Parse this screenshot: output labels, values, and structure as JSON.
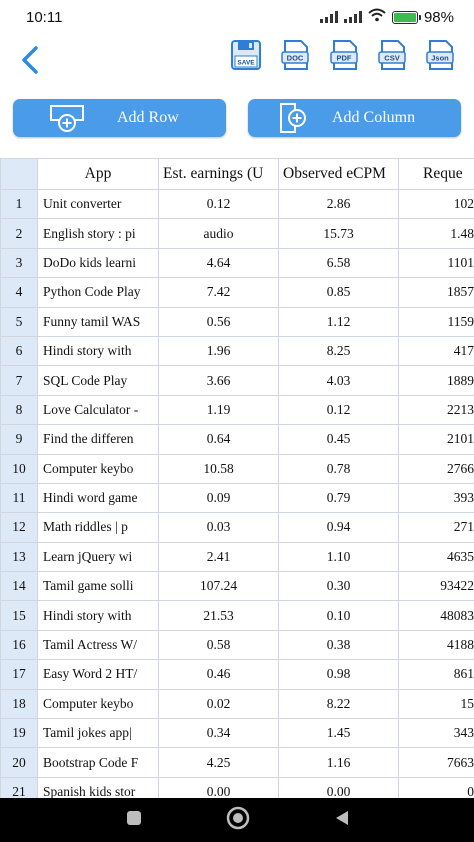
{
  "status": {
    "time": "10:11",
    "battery": "98%",
    "icons": [
      "signal-icon",
      "signal-icon",
      "wifi-icon",
      "battery-icon"
    ]
  },
  "toolbar": {
    "back_icon": "back-arrow-icon",
    "formats": [
      {
        "name": "save",
        "label": "SAVE"
      },
      {
        "name": "doc",
        "label": "DOC"
      },
      {
        "name": "pdf",
        "label": "PDF"
      },
      {
        "name": "csv",
        "label": "CSV"
      },
      {
        "name": "json",
        "label": "Json"
      }
    ],
    "accent": "#2d8ae0"
  },
  "actions": {
    "add_row": "Add Row",
    "add_column": "Add Column",
    "button_color": "#4a9be8"
  },
  "table": {
    "headers": [
      "App",
      "Est. earnings (U",
      "Observed eCPM",
      "Reque"
    ],
    "rows": [
      {
        "n": "1",
        "app": "Unit converter",
        "earn": "0.12",
        "ecpm": "2.86",
        "req": "102"
      },
      {
        "n": "2",
        "app": "English story : pi",
        "earn": "audio",
        "ecpm": "15.73",
        "req": "1.48"
      },
      {
        "n": "3",
        "app": "DoDo kids learni",
        "earn": "4.64",
        "ecpm": "6.58",
        "req": "1101"
      },
      {
        "n": "4",
        "app": "Python Code Play",
        "earn": "7.42",
        "ecpm": "0.85",
        "req": "1857"
      },
      {
        "n": "5",
        "app": "Funny tamil WAS",
        "earn": "0.56",
        "ecpm": "1.12",
        "req": "1159"
      },
      {
        "n": "6",
        "app": "Hindi story with",
        "earn": "1.96",
        "ecpm": "8.25",
        "req": "417"
      },
      {
        "n": "7",
        "app": "SQL Code Play",
        "earn": "3.66",
        "ecpm": "4.03",
        "req": "1889"
      },
      {
        "n": "8",
        "app": "Love Calculator -",
        "earn": "1.19",
        "ecpm": "0.12",
        "req": "2213"
      },
      {
        "n": "9",
        "app": "Find the differen",
        "earn": "0.64",
        "ecpm": "0.45",
        "req": "2101"
      },
      {
        "n": "10",
        "app": "Computer keybo",
        "earn": "10.58",
        "ecpm": "0.78",
        "req": "2766"
      },
      {
        "n": "11",
        "app": "Hindi word game",
        "earn": "0.09",
        "ecpm": "0.79",
        "req": "393"
      },
      {
        "n": "12",
        "app": "Math riddles | p",
        "earn": "0.03",
        "ecpm": "0.94",
        "req": "271"
      },
      {
        "n": "13",
        "app": "Learn jQuery wi",
        "earn": "2.41",
        "ecpm": "1.10",
        "req": "4635"
      },
      {
        "n": "14",
        "app": "Tamil game solli",
        "earn": "107.24",
        "ecpm": "0.30",
        "req": "93422"
      },
      {
        "n": "15",
        "app": "Hindi story with",
        "earn": "21.53",
        "ecpm": "0.10",
        "req": "48083"
      },
      {
        "n": "16",
        "app": "Tamil Actress W/",
        "earn": "0.58",
        "ecpm": "0.38",
        "req": "4188"
      },
      {
        "n": "17",
        "app": "Easy Word 2 HT/",
        "earn": "0.46",
        "ecpm": "0.98",
        "req": "861"
      },
      {
        "n": "18",
        "app": "Computer keybo",
        "earn": "0.02",
        "ecpm": "8.22",
        "req": "15"
      },
      {
        "n": "19",
        "app": "Tamil jokes app|",
        "earn": "0.34",
        "ecpm": "1.45",
        "req": "343"
      },
      {
        "n": "20",
        "app": "Bootstrap Code F",
        "earn": "4.25",
        "ecpm": "1.16",
        "req": "7663"
      },
      {
        "n": "21",
        "app": "Spanish kids stor",
        "earn": "0.00",
        "ecpm": "0.00",
        "req": "0"
      }
    ],
    "rownum_bg": "#dde9f7"
  },
  "nav": {
    "icons": [
      "recents-square-icon",
      "home-circle-icon",
      "back-triangle-icon"
    ]
  }
}
